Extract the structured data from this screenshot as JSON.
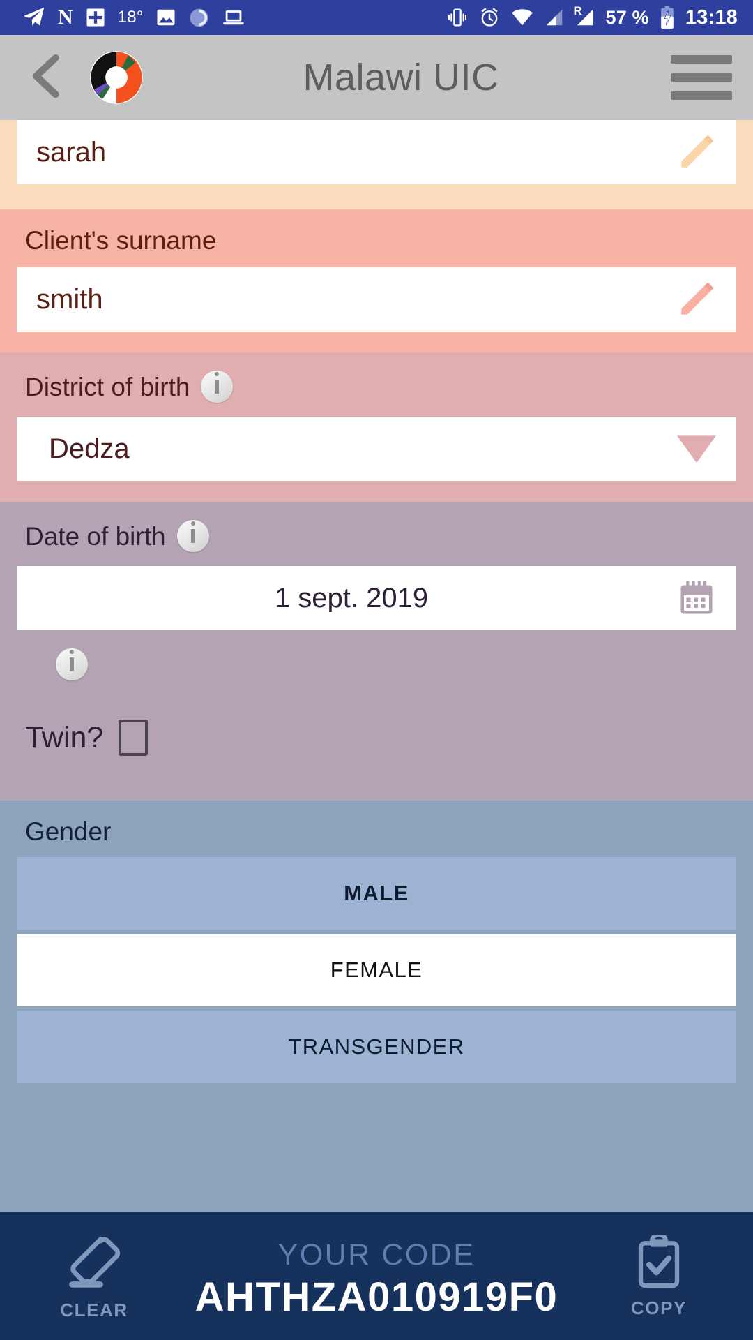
{
  "status_bar": {
    "left_icons": [
      "telegram-icon",
      "netflix-icon",
      "calendar-plus-icon",
      "temperature-icon",
      "gallery-icon",
      "sync-icon",
      "laptop-icon"
    ],
    "temperature": "18°",
    "right_icons": [
      "vibrate-icon",
      "alarm-icon",
      "wifi-icon",
      "signal-icon",
      "roaming-signal-icon",
      "battery-charging-icon"
    ],
    "battery": "57 %",
    "roaming_label": "R",
    "time": "13:18"
  },
  "app_bar": {
    "back_icon": "chevron-left-icon",
    "logo_icon": "app-logo-icon",
    "title": "Malawi UIC",
    "menu_icon": "hamburger-menu-icon"
  },
  "form": {
    "first_name": {
      "value": "sarah",
      "edit_icon": "pencil-icon",
      "background": "#fbdcbd"
    },
    "surname": {
      "label": "Client's surname",
      "value": "smith",
      "edit_icon": "pencil-icon",
      "background": "#f7b4a6"
    },
    "district": {
      "label": "District of birth",
      "info_icon": "info-icon",
      "value": "Dedza",
      "dropdown_icon": "chevron-down-icon",
      "background": "#e0aeb0"
    },
    "date_of_birth": {
      "label": "Date of birth",
      "info_icon": "info-icon",
      "value": "1 sept. 2019",
      "calendar_icon": "calendar-icon",
      "twin_info_icon": "info-icon",
      "twin_label": "Twin?",
      "twin_checked": false,
      "background": "#b3a3b3"
    },
    "gender": {
      "label": "Gender",
      "options": [
        {
          "label": "MALE",
          "selected": false
        },
        {
          "label": "FEMALE",
          "selected": true
        },
        {
          "label": "TRANSGENDER",
          "selected": false
        }
      ],
      "background": "#8da3bc"
    }
  },
  "bottom_bar": {
    "clear_icon": "eraser-icon",
    "clear_label": "CLEAR",
    "code_title": "YOUR CODE",
    "code_value": "AHTHZA010919F0",
    "copy_icon": "clipboard-check-icon",
    "copy_label": "COPY",
    "background": "#16325c"
  }
}
